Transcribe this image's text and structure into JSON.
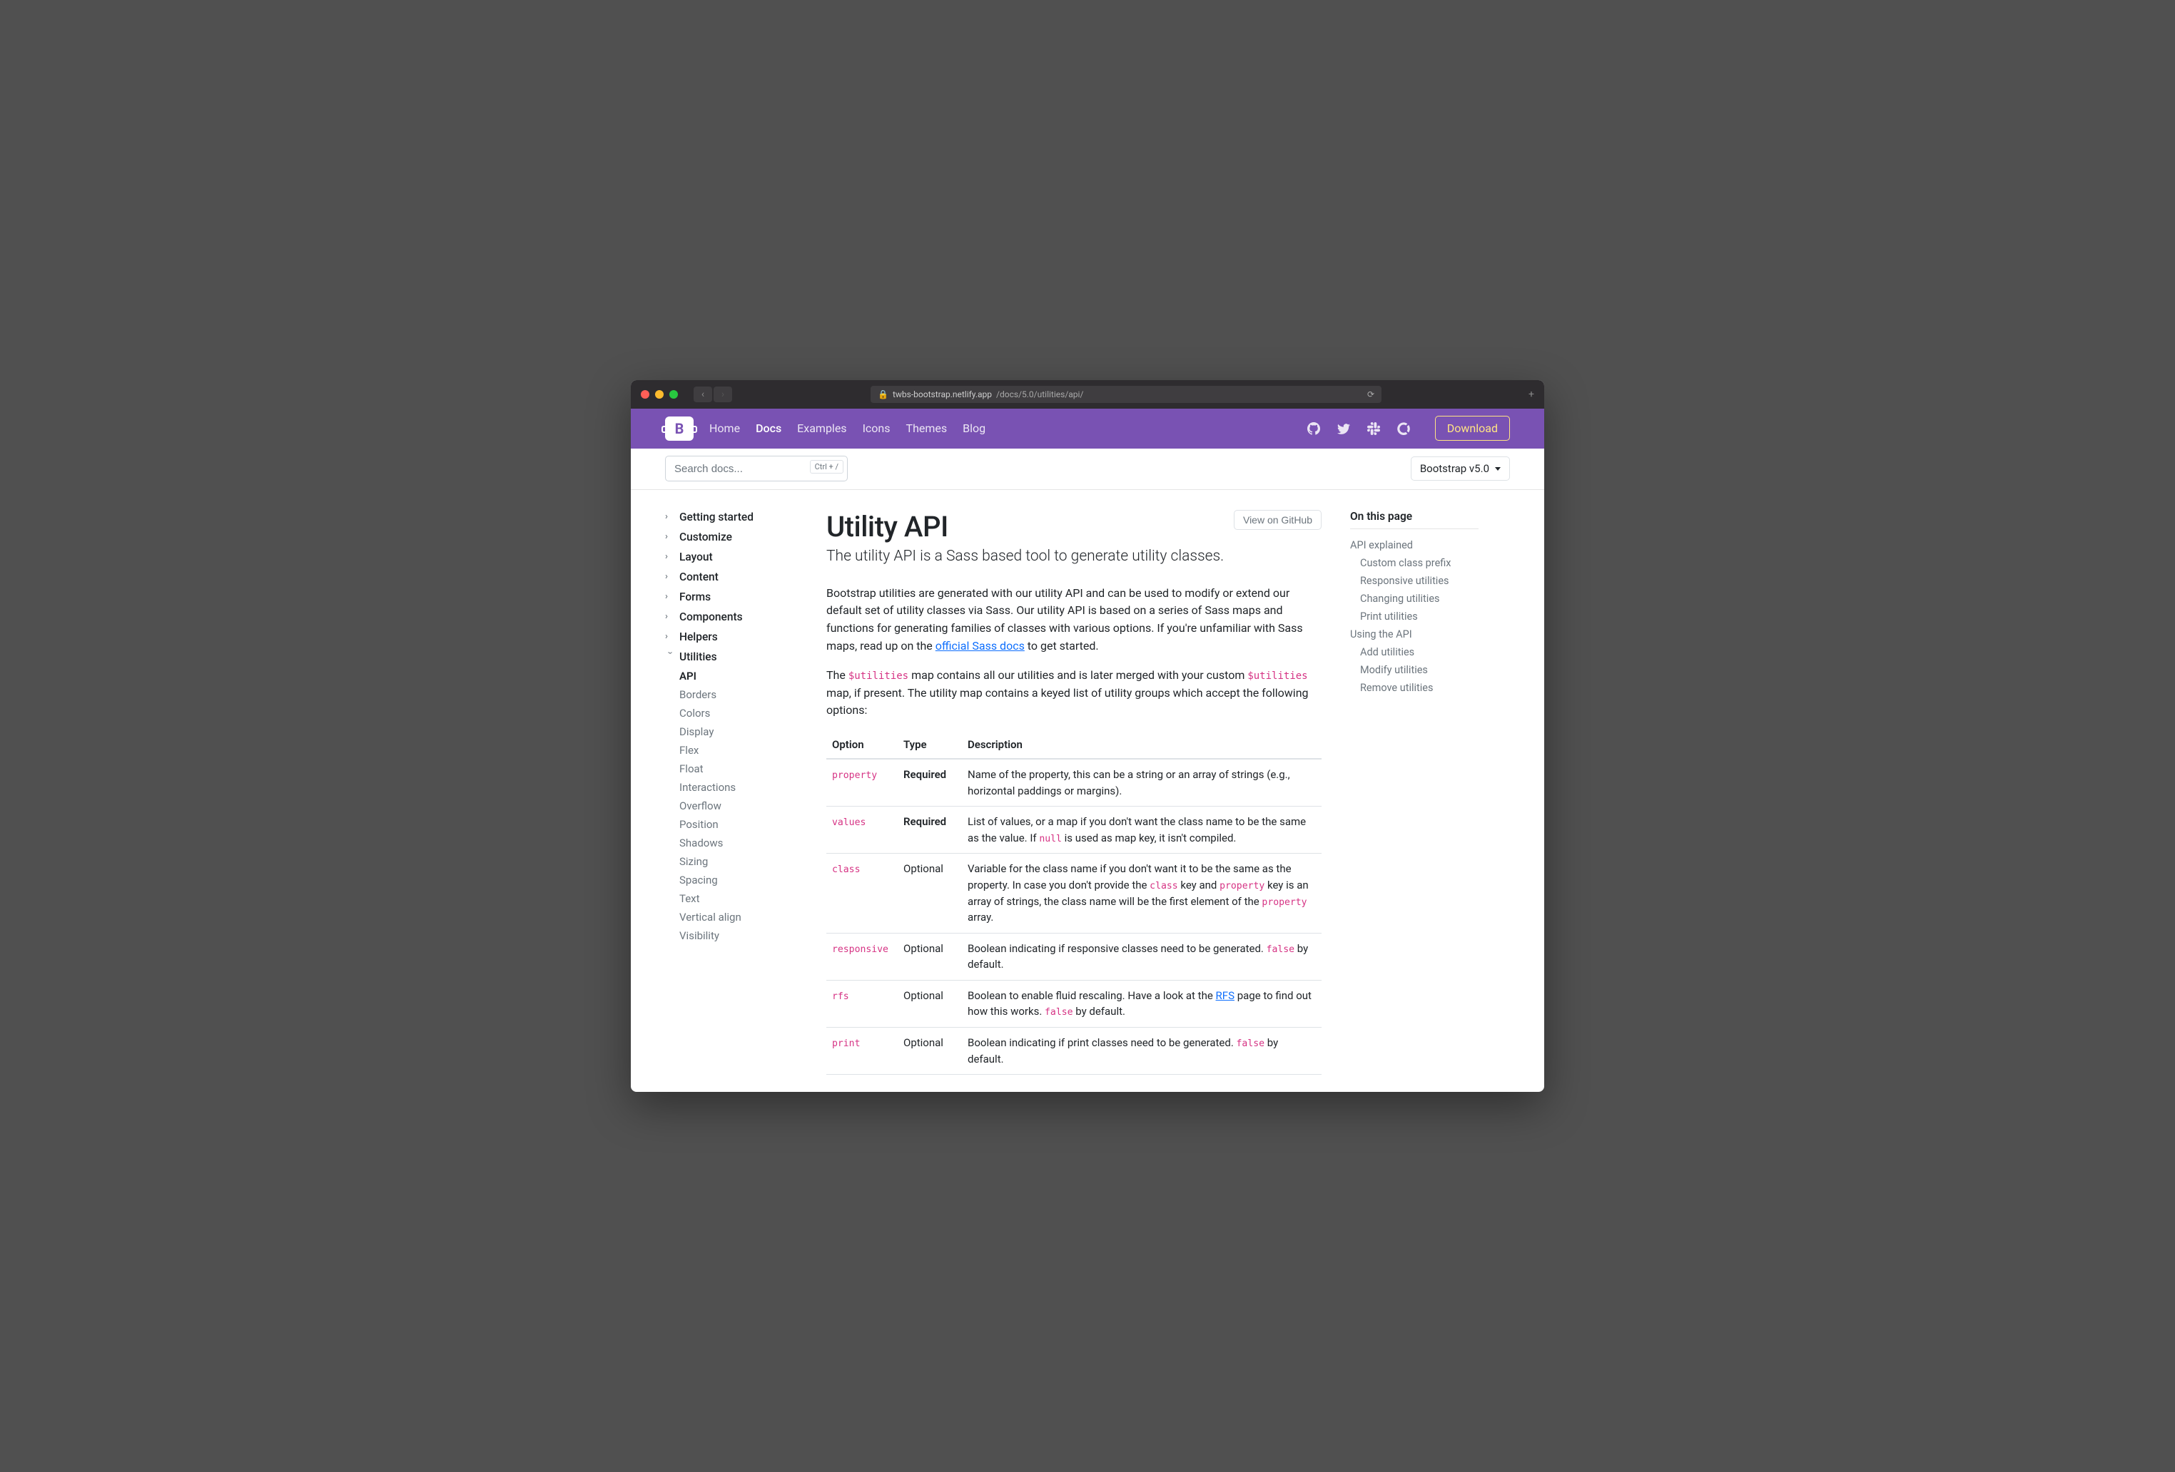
{
  "browser": {
    "host": "twbs-bootstrap.netlify.app",
    "path": "/docs/5.0/utilities/api/"
  },
  "topnav": {
    "links": [
      "Home",
      "Docs",
      "Examples",
      "Icons",
      "Themes",
      "Blog"
    ],
    "active": "Docs",
    "download": "Download"
  },
  "subbar": {
    "placeholder": "Search docs...",
    "shortcut": "Ctrl + /",
    "version": "Bootstrap v5.0"
  },
  "sidebar": {
    "groups": [
      "Getting started",
      "Customize",
      "Layout",
      "Content",
      "Forms",
      "Components",
      "Helpers"
    ],
    "expanded": "Utilities",
    "items": [
      "API",
      "Borders",
      "Colors",
      "Display",
      "Flex",
      "Float",
      "Interactions",
      "Overflow",
      "Position",
      "Shadows",
      "Sizing",
      "Spacing",
      "Text",
      "Vertical align",
      "Visibility"
    ],
    "active": "API"
  },
  "page": {
    "title": "Utility API",
    "ghbtn": "View on GitHub",
    "lead": "The utility API is a Sass based tool to generate utility classes.",
    "intro1_a": "Bootstrap utilities are generated with our utility API and can be used to modify or extend our default set of utility classes via Sass. Our utility API is based on a series of Sass maps and functions for generating families of classes with various options. If you're unfamiliar with Sass maps, read up on the ",
    "intro1_link": "official Sass docs",
    "intro1_b": " to get started.",
    "intro2_a": "The ",
    "intro2_code1": "$utilities",
    "intro2_b": " map contains all our utilities and is later merged with your custom ",
    "intro2_code2": "$utilities",
    "intro2_c": " map, if present. The utility map contains a keyed list of utility groups which accept the following options:",
    "th": [
      "Option",
      "Type",
      "Description"
    ],
    "rows": [
      {
        "opt": "property",
        "type": "Required",
        "desc": "Name of the property, this can be a string or an array of strings (e.g., horizontal paddings or margins)."
      },
      {
        "opt": "values",
        "type": "Required",
        "desc_a": "List of values, or a map if you don't want the class name to be the same as the value. If ",
        "c1": "null",
        "desc_b": " is used as map key, it isn't compiled."
      },
      {
        "opt": "class",
        "type": "Optional",
        "desc_a": "Variable for the class name if you don't want it to be the same as the property. In case you don't provide the ",
        "c1": "class",
        "desc_b": " key and ",
        "c2": "property",
        "desc_c": " key is an array of strings, the class name will be the first element of the ",
        "c3": "property",
        "desc_d": " array."
      },
      {
        "opt": "responsive",
        "type": "Optional",
        "desc_a": "Boolean indicating if responsive classes need to be generated. ",
        "c1": "false",
        "desc_b": " by default."
      },
      {
        "opt": "rfs",
        "type": "Optional",
        "desc_a": "Boolean to enable fluid rescaling. Have a look at the ",
        "link": "RFS",
        "desc_b": " page to find out how this works. ",
        "c1": "false",
        "desc_c": " by default."
      },
      {
        "opt": "print",
        "type": "Optional",
        "desc_a": "Boolean indicating if print classes need to be generated. ",
        "c1": "false",
        "desc_b": " by default."
      }
    ]
  },
  "toc": {
    "title": "On this page",
    "items": [
      {
        "t": "API explained",
        "l": 0
      },
      {
        "t": "Custom class prefix",
        "l": 1
      },
      {
        "t": "Responsive utilities",
        "l": 1
      },
      {
        "t": "Changing utilities",
        "l": 1
      },
      {
        "t": "Print utilities",
        "l": 1
      },
      {
        "t": "Using the API",
        "l": 0
      },
      {
        "t": "Add utilities",
        "l": 1
      },
      {
        "t": "Modify utilities",
        "l": 1
      },
      {
        "t": "Remove utilities",
        "l": 1
      }
    ]
  }
}
